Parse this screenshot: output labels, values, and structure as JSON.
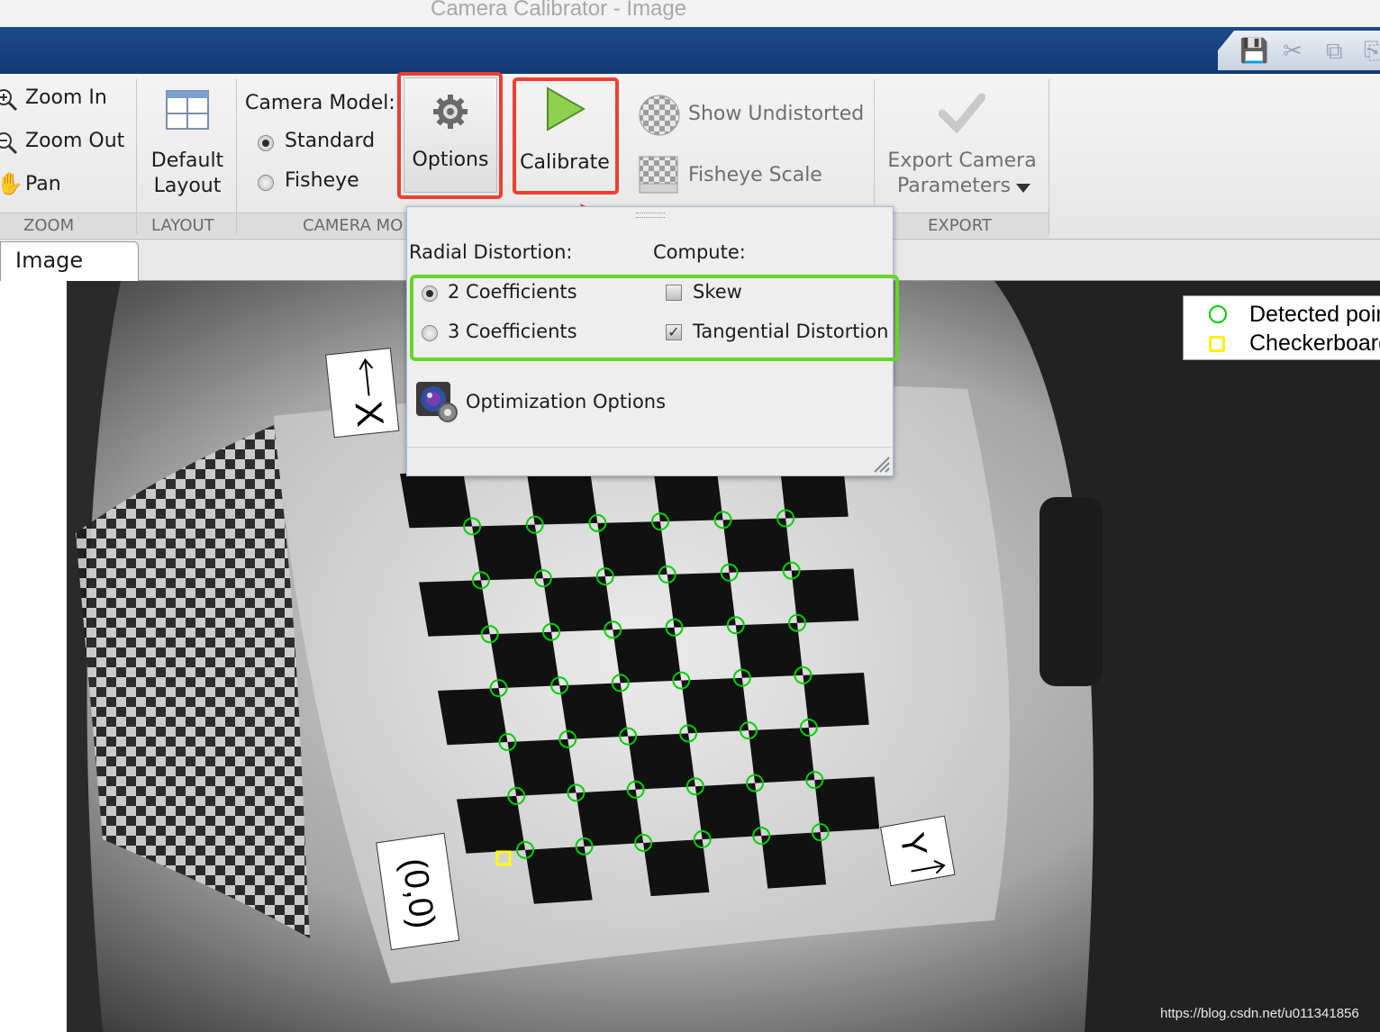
{
  "window": {
    "title": "Camera Calibrator - Image"
  },
  "toolbar": {
    "zoom": {
      "zoom_in": "Zoom In",
      "zoom_out": "Zoom Out",
      "pan": "Pan",
      "group": "ZOOM"
    },
    "layout": {
      "default_line1": "Default",
      "default_line2": "Layout",
      "group": "LAYOUT"
    },
    "camera_model": {
      "label": "Camera Model:",
      "standard": "Standard",
      "fisheye": "Fisheye",
      "group": "CAMERA MO",
      "selected": "Standard"
    },
    "options": {
      "label": "Options"
    },
    "calibrate": {
      "label": "Calibrate"
    },
    "view": {
      "show_undistorted": "Show Undistorted",
      "fisheye_scale": "Fisheye Scale"
    },
    "export": {
      "line1": "Export Camera",
      "line2": "Parameters",
      "group": "EXPORT"
    }
  },
  "tabs": [
    {
      "label": "Image",
      "active": true
    }
  ],
  "options_popup": {
    "radial_label": "Radial Distortion:",
    "compute_label": "Compute:",
    "radial_options": [
      {
        "label": "2 Coefficients",
        "selected": true
      },
      {
        "label": "3 Coefficients",
        "selected": false
      }
    ],
    "compute_options": [
      {
        "label": "Skew",
        "checked": false
      },
      {
        "label": "Tangential Distortion",
        "checked": true
      }
    ],
    "optimization": "Optimization Options"
  },
  "legend": [
    {
      "label": "Detected points",
      "color": "#00d000"
    },
    {
      "label": "Checkerboard origin",
      "color": "#ffff00"
    }
  ],
  "axis_labels": {
    "x": "X",
    "y": "Y",
    "origin": "(0,0)"
  },
  "annotations": {
    "highlight_red": "#ef3f2f",
    "highlight_green": "#63d628",
    "arrow_color": "#ef3f2f"
  },
  "watermark": "https://blog.csdn.net/u011341856"
}
